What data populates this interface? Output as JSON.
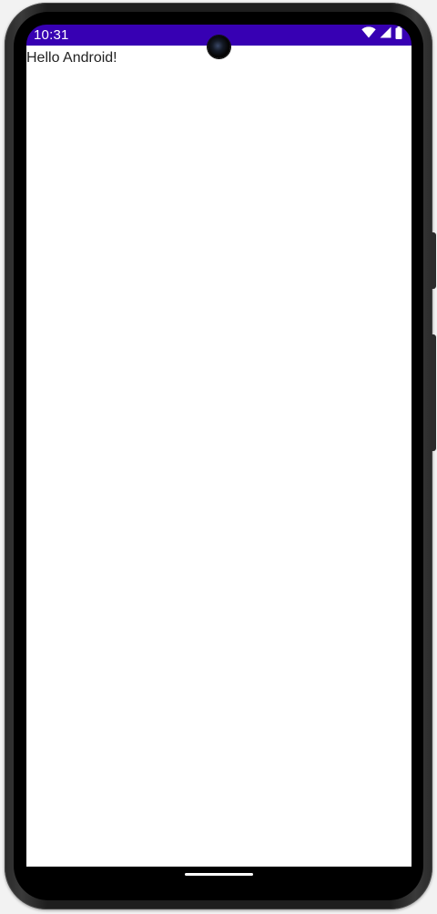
{
  "status_bar": {
    "time": "10:31",
    "background_color": "#3700b3",
    "icons": [
      "wifi-icon",
      "cellular-signal-icon",
      "battery-icon"
    ]
  },
  "app": {
    "greeting_text": "Hello Android!"
  },
  "navigation": {
    "gesture_handle": "home-gesture-handle"
  }
}
